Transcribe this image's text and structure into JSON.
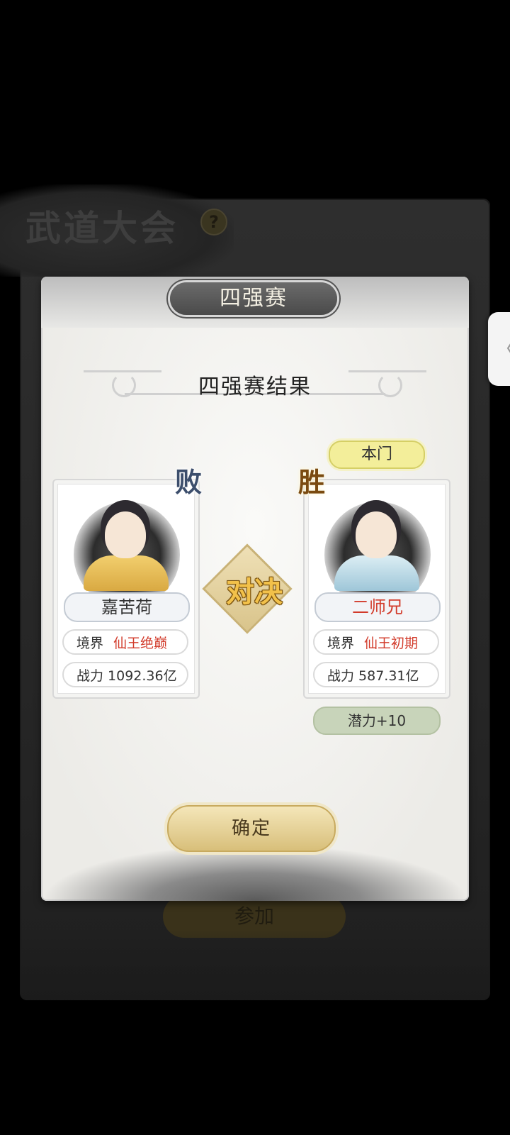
{
  "background": {
    "title": "武道大会",
    "help_icon": "?",
    "join_label": "参加"
  },
  "dialog": {
    "title": "四强赛",
    "heading": "四强赛结果",
    "vs_label": "对决",
    "confirm_label": "确定"
  },
  "left_player": {
    "result": "败",
    "name": "嘉苦荷",
    "realm_label": "境界",
    "realm_value": "仙王绝巅",
    "power_text": "战力 1092.36亿"
  },
  "right_player": {
    "tag": "本门",
    "result": "胜",
    "name": "二师兄",
    "realm_label": "境界",
    "realm_value": "仙王初期",
    "power_text": "战力 587.31亿",
    "reward": "潜力+10"
  },
  "side_handle_glyph": "〈",
  "colors": {
    "accent_gold": "#f2c14a",
    "realm_red": "#d23a2a",
    "reward_green": "#c8d4ba",
    "sect_tag_yellow": "#f3ee9a"
  }
}
